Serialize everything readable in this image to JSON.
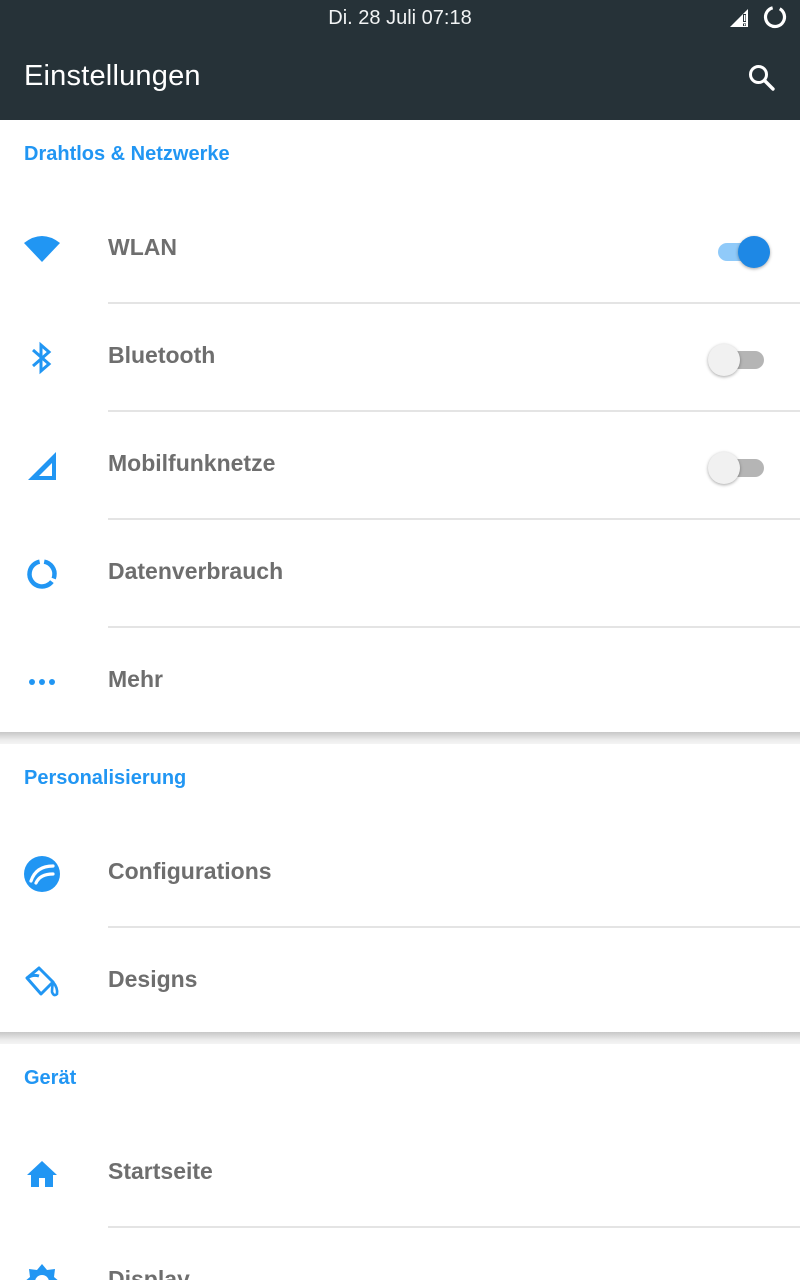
{
  "status_bar": {
    "datetime": "Di. 28 Juli 07:18",
    "icons": [
      "signal-alert-icon",
      "battery-ring-icon"
    ]
  },
  "app_bar": {
    "title": "Einstellungen",
    "action_icon": "search-icon"
  },
  "colors": {
    "app_bar": "#263238",
    "accent": "#2196f3",
    "label_text": "#6e6e6e"
  },
  "sections": [
    {
      "header": "Drahtlos & Netzwerke",
      "items": [
        {
          "label": "WLAN",
          "icon": "wifi-icon",
          "toggle": "on"
        },
        {
          "label": "Bluetooth",
          "icon": "bluetooth-icon",
          "toggle": "off"
        },
        {
          "label": "Mobilfunknetze",
          "icon": "cellular-signal-icon",
          "toggle": "off"
        },
        {
          "label": "Datenverbrauch",
          "icon": "data-usage-icon"
        },
        {
          "label": "Mehr",
          "icon": "more-dots-icon"
        }
      ]
    },
    {
      "header": "Personalisierung",
      "items": [
        {
          "label": "Configurations",
          "icon": "configurations-icon"
        },
        {
          "label": "Designs",
          "icon": "paint-bucket-icon"
        }
      ]
    },
    {
      "header": "Gerät",
      "items": [
        {
          "label": "Startseite",
          "icon": "home-icon"
        },
        {
          "label": "Display",
          "icon": "display-brightness-icon"
        }
      ]
    }
  ]
}
